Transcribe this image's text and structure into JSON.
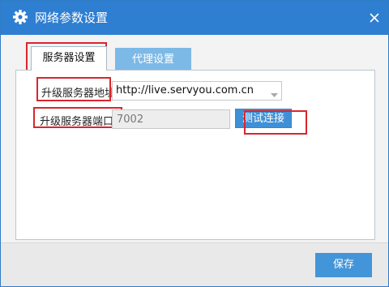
{
  "window": {
    "title": "网络参数设置",
    "icon": "gear-icon",
    "close_icon": "close-icon"
  },
  "tabs": [
    {
      "label": "服务器设置",
      "active": true
    },
    {
      "label": "代理设置",
      "active": false
    }
  ],
  "form": {
    "server_address_label": "升级服务器地址",
    "server_address_value": "http://live.servyou.com.cn",
    "server_port_label": "升级服务器端口：",
    "server_port_value": "7002",
    "test_button_label": "测试连接"
  },
  "footer": {
    "save_label": "保存"
  },
  "colors": {
    "titlebar": "#2e7ed1",
    "highlight": "#d9262c",
    "button": "#4295d8"
  }
}
